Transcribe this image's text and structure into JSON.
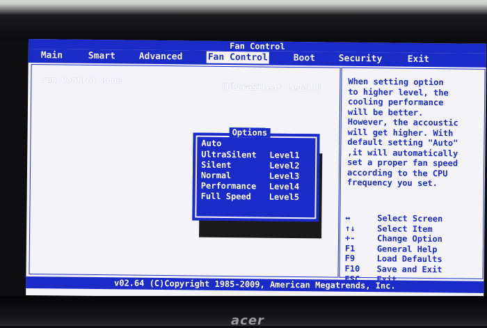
{
  "monitor": {
    "brand": "acer"
  },
  "bios": {
    "title": "Fan Control",
    "menu": [
      {
        "label": "Main"
      },
      {
        "label": "Smart"
      },
      {
        "label": "Advanced"
      },
      {
        "label": "Fan Control"
      },
      {
        "label": "Boot"
      },
      {
        "label": "Security"
      },
      {
        "label": "Exit"
      }
    ],
    "active_menu": "Fan Control",
    "setting": {
      "label": "Fan Control Mode",
      "value": "[UltraSilent Level1]"
    },
    "popup": {
      "title": "Options",
      "options": [
        {
          "name": "Auto",
          "level": ""
        },
        {
          "name": "UltraSilent",
          "level": "Level1"
        },
        {
          "name": "Silent",
          "level": "Level2"
        },
        {
          "name": "Normal",
          "level": "Level3"
        },
        {
          "name": "Performance",
          "level": "Level4"
        },
        {
          "name": "Full Speed",
          "level": "Level5"
        }
      ]
    },
    "help": "When setting option\nto higher level, the\ncooling performance\nwill be better.\nHowever, the accoustic\nwill get higher. With\ndefault setting \"Auto\"\n,it will automatically\nset a proper fan speed\naccording to the CPU\nfrequency you set.",
    "keys": [
      {
        "key": "↔",
        "desc": "Select Screen"
      },
      {
        "key": "↑↓",
        "desc": "Select Item"
      },
      {
        "key": "+-",
        "desc": "Change Option"
      },
      {
        "key": "F1",
        "desc": "General Help"
      },
      {
        "key": "F9",
        "desc": "Load Defaults"
      },
      {
        "key": "F10",
        "desc": "Save and Exit"
      },
      {
        "key": "ESC",
        "desc": "Exit"
      }
    ],
    "footer": "v02.64 (C)Copyright 1985-2009, American Megatrends, Inc."
  },
  "colors": {
    "bios_blue": "#1b2bc8",
    "screen_bg": "#f4f4f8"
  }
}
